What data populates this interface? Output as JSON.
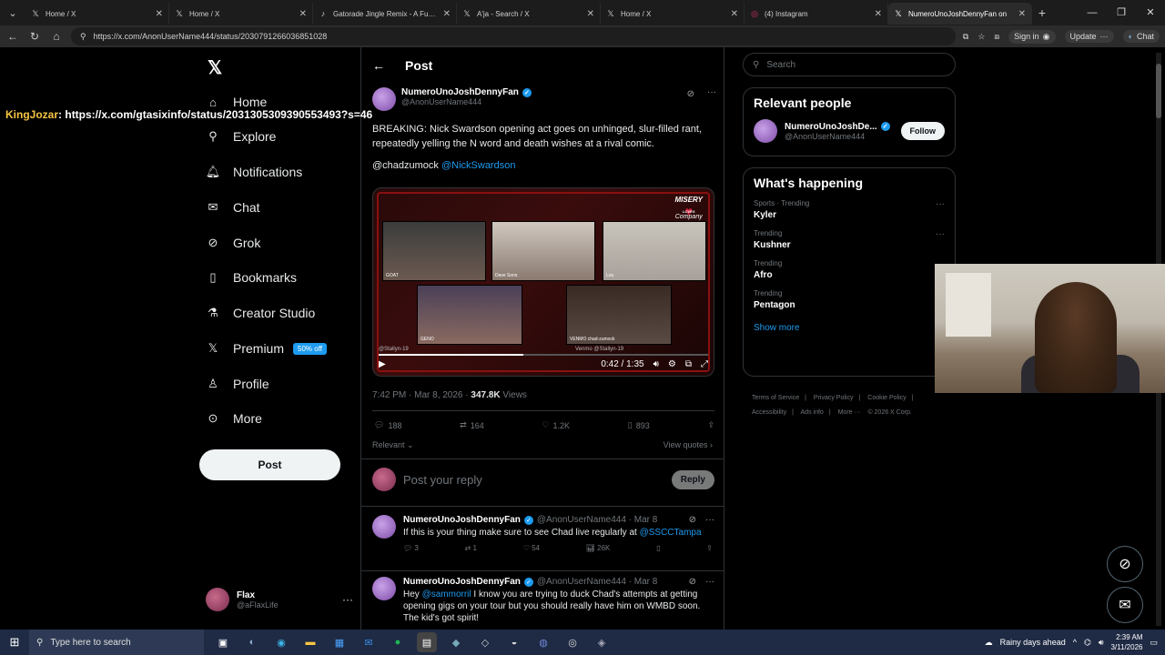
{
  "browser": {
    "tabs": [
      {
        "title": "Home / X",
        "icon": "x-logo-icon"
      },
      {
        "title": "Home / X",
        "icon": "x-logo-icon"
      },
      {
        "title": "Gatorade Jingle Remix - A Fun Tw",
        "icon": "tiktok-icon"
      },
      {
        "title": "A'ja - Search / X",
        "icon": "x-logo-icon"
      },
      {
        "title": "Home / X",
        "icon": "x-logo-icon"
      },
      {
        "title": "(4) Instagram",
        "icon": "instagram-icon"
      },
      {
        "title": "NumeroUnoJoshDennyFan on",
        "icon": "x-logo-icon",
        "active": true
      }
    ],
    "url": "https://x.com/AnonUserName444/status/2030791266036851028",
    "sign_in": "Sign in",
    "update": "Update",
    "chat": "Chat"
  },
  "overlay": {
    "name": "KingJozar",
    "link": "https://x.com/gtasixinfo/status/2031305309390553493?s=46"
  },
  "nav": {
    "items": [
      "Home",
      "Explore",
      "Notifications",
      "Chat",
      "Grok",
      "Bookmarks",
      "Creator Studio",
      "Premium",
      "Profile",
      "More"
    ],
    "premium_badge": "50% off",
    "post": "Post",
    "account_name": "Flax",
    "account_handle": "@aFlaxLife"
  },
  "post": {
    "header": "Post",
    "author": "NumeroUnoJoshDennyFan",
    "handle": "@AnonUserName444",
    "text": "BREAKING: Nick Swardson opening act goes on unhinged, slur-filled rant, repeatedly yelling the N word and death wishes at a rival comic.",
    "mentions_a": "@chadzumock",
    "mentions_b": "@NickSwardson",
    "video_time": "0:42 / 1:35",
    "video_progress": 0.44,
    "misery_text": "MISERY",
    "loves": "LOVES",
    "company": "Company",
    "cam_labels": [
      "GOAT",
      "Dave Sons",
      "Lou",
      "GENO",
      "VENMO chad-zumock"
    ],
    "watermark_a": "@Stallyn-19",
    "watermark_b": "Venmo @Stallyn-19",
    "time": "7:42 PM · Mar 8, 2026 ·",
    "views": "347.8K",
    "views_label": "Views",
    "replies": "188",
    "reposts": "164",
    "likes": "1.2K",
    "bookmarks": "893",
    "relevant": "Relevant",
    "view_quotes": "View quotes",
    "reply_placeholder": "Post your reply",
    "reply_button": "Reply"
  },
  "replies": [
    {
      "author": "NumeroUnoJoshDennyFan",
      "handle": "@AnonUserName444 · Mar 8",
      "text_a": "If this is your thing make sure to see Chad live regularly at",
      "text_mention": "@SSCCTampa",
      "comments": "3",
      "reposts": "1",
      "likes": "54",
      "views": "26K"
    },
    {
      "author": "NumeroUnoJoshDennyFan",
      "handle": "@AnonUserName444 · Mar 8",
      "text_a": "Hey",
      "text_mention": "@sammorril",
      "text_b": "I know you are trying to duck Chad's attempts at getting opening gigs on your tour but you should really have him on WMBD soon. The kid's got spirit!"
    }
  ],
  "right": {
    "search_placeholder": "Search",
    "relevant_title": "Relevant people",
    "person_name": "NumeroUnoJoshDe...",
    "person_handle": "@AnonUserName444",
    "follow": "Follow",
    "happening_title": "What's happening",
    "trends": [
      {
        "cat": "Sports · Trending",
        "topic": "Kyler"
      },
      {
        "cat": "Trending",
        "topic": "Kushner"
      },
      {
        "cat": "Trending",
        "topic": "Afro"
      },
      {
        "cat": "Trending",
        "topic": "Pentagon"
      }
    ],
    "show_more": "Show more",
    "footer": [
      "Terms of Service",
      "|",
      "Privacy Policy",
      "|",
      "Cookie Policy",
      "|",
      "Accessibility",
      "|",
      "Ads info",
      "|",
      "More ···",
      "© 2026 X Corp."
    ]
  },
  "taskbar": {
    "search": "Type here to search",
    "weather": "Rainy days ahead",
    "time": "2:39 AM",
    "date": "3/11/2026"
  }
}
